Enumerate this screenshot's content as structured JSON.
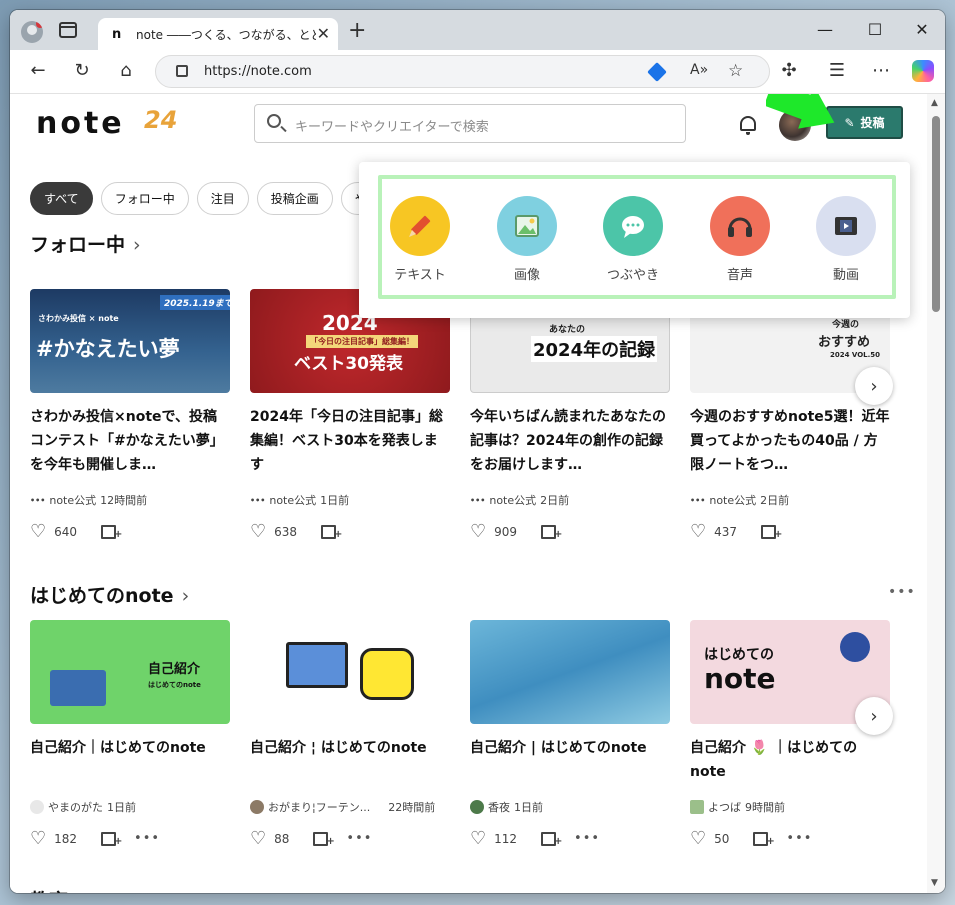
{
  "browser": {
    "tab_title": "note ――つくる、つながる、とどける。",
    "tab_favicon": "n",
    "url": "https://note.com",
    "new_tab": "+",
    "close": "✕"
  },
  "header": {
    "logo": "note",
    "logo_badge": "24",
    "search_placeholder": "キーワードやクリエイターで検索",
    "post_button": "投稿"
  },
  "chips": [
    "すべて",
    "フォロー中",
    "注目",
    "投稿企画",
    "や"
  ],
  "post_menu": {
    "items": [
      {
        "label": "テキスト",
        "color": "#f7c623",
        "icon": "pencil-icon"
      },
      {
        "label": "画像",
        "color": "#7fd0e0",
        "icon": "image-icon"
      },
      {
        "label": "つぶやき",
        "color": "#4cc5a8",
        "icon": "speech-bubble-icon"
      },
      {
        "label": "音声",
        "color": "#f0705a",
        "icon": "headphones-icon"
      },
      {
        "label": "動画",
        "color": "#d9dff0",
        "icon": "film-icon"
      }
    ]
  },
  "sections": [
    {
      "title": "フォロー中",
      "cards": [
        {
          "thumb_main": "#かなえたい夢",
          "thumb_top": "2025.1.19まで",
          "thumb_sub": "さわかみ投信 × note",
          "title": "さわかみ投信×noteで、投稿コンテスト「#かなえたい夢」を今年も開催しま…",
          "author": "note公式",
          "time": "12時間前",
          "likes": "640"
        },
        {
          "thumb_main": "ベスト30発表",
          "thumb_top": "2024",
          "thumb_sub": "「今日の注目記事」総集編！",
          "title": "2024年「今日の注目記事」総集編！ベスト30本を発表します",
          "author": "note公式",
          "time": "1日前",
          "likes": "638"
        },
        {
          "thumb_main": "2024年の記録",
          "thumb_top": "あなたの",
          "thumb_sub": "",
          "title": "今年いちばん読まれたあなたの記事は？2024年の創作の記録をお届けします…",
          "author": "note公式",
          "time": "2日前",
          "likes": "909"
        },
        {
          "thumb_main": "おすすめ",
          "thumb_top": "今週の",
          "thumb_sub": "2024 VOL.50",
          "title": "今週のおすすめnote5選！近年買ってよかったもの40品 / 方限ノートをつ…",
          "author": "note公式",
          "time": "2日前",
          "likes": "437"
        }
      ]
    },
    {
      "title": "はじめてのnote",
      "cards": [
        {
          "thumb_main": "自己紹介",
          "thumb_sub": "はじめてのnote",
          "title": "自己紹介｜はじめてのnote",
          "author": "やまのがた",
          "time": "1日前",
          "likes": "182"
        },
        {
          "thumb_main": "",
          "thumb_sub": "",
          "title": "自己紹介 ¦ はじめてのnote",
          "author": "おがまり¦フーテン...",
          "time": "22時間前",
          "likes": "88"
        },
        {
          "thumb_main": "",
          "thumb_sub": "",
          "title": "自己紹介 | はじめてのnote",
          "author": "香夜",
          "time": "1日前",
          "likes": "112"
        },
        {
          "thumb_main": "note",
          "thumb_top": "はじめての",
          "thumb_sub": "",
          "title": "自己紹介 🌷 ｜はじめてのnote",
          "author": "よつば",
          "time": "9時間前",
          "likes": "50"
        }
      ]
    },
    {
      "title": "教育",
      "cards": []
    }
  ],
  "colors": {
    "accent": "#2b7a6d",
    "highlight": "#b9f2b9",
    "arrow": "#1ee82a"
  }
}
